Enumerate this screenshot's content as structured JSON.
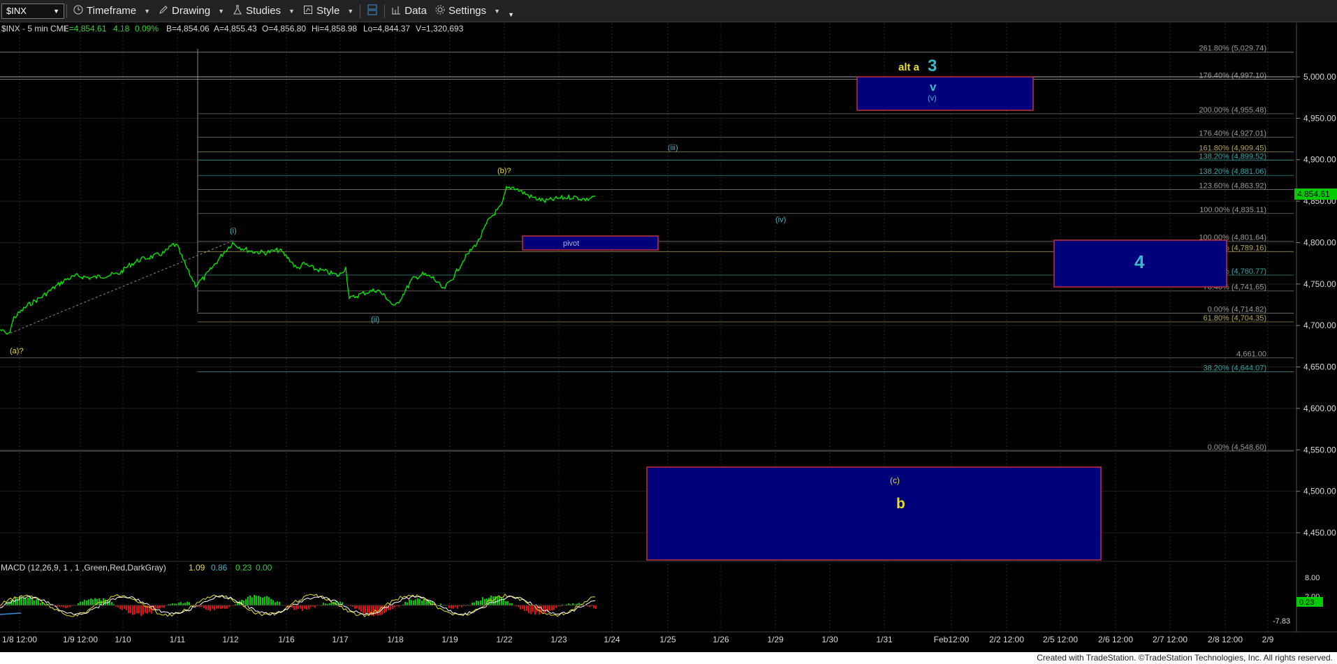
{
  "toolbar": {
    "symbol": "$INX",
    "timeframe": "Timeframe",
    "drawing": "Drawing",
    "studies": "Studies",
    "style": "Style",
    "data": "Data",
    "settings": "Settings"
  },
  "header": {
    "symbol_info": "$INX - 5 min  CME",
    "last": "L=4,854.61",
    "change": "4.18",
    "change_pct": "0.09%",
    "bid": "B=4,854.06",
    "ask": "A=4,855.43",
    "open": "O=4,856.80",
    "high": "Hi=4,858.98",
    "low": "Lo=4,844.37",
    "volume": "V=1,320,693"
  },
  "price_axis": {
    "ticks": [
      "5,000.00",
      "4,950.00",
      "4,900.00",
      "4,850.00",
      "4,800.00",
      "4,750.00",
      "4,700.00",
      "4,650.00",
      "4,600.00",
      "4,550.00",
      "4,500.00",
      "4,450.00"
    ],
    "last_price_label": "4,854.61"
  },
  "time_axis": {
    "ticks": [
      "1/8 12:00",
      "1/9 12:00",
      "1/10",
      "1/11",
      "1/12",
      "1/16",
      "1/17",
      "1/18",
      "1/19",
      "1/22",
      "1/23",
      "1/24",
      "1/25",
      "1/26",
      "1/29",
      "1/30",
      "1/31",
      "Feb12:00",
      "2/2 12:00",
      "2/5 12:00",
      "2/6 12:00",
      "2/7 12:00",
      "2/8 12:00",
      "2/9"
    ]
  },
  "fib_levels": [
    {
      "label": "261.80% (5,029.74)",
      "price": 5029.74,
      "color": "#9a9a9a"
    },
    {
      "label": "176.40% (4,997.10)",
      "price": 4997.1,
      "color": "#9a9a9a"
    },
    {
      "label": "200.00% (4,955.48)",
      "price": 4955.48,
      "color": "#9a9a9a"
    },
    {
      "label": "176.40% (4,927.01)",
      "price": 4927.01,
      "color": "#9a9a9a"
    },
    {
      "label": "161.80% (4,909.45)",
      "price": 4909.45,
      "color": "#b3a45a"
    },
    {
      "label": "138.20% (4,899.52)",
      "price": 4899.52,
      "color": "#3aa3a3"
    },
    {
      "label": "138.20% (4,881.06)",
      "price": 4881.06,
      "color": "#3aa3a3"
    },
    {
      "label": "123.60% (4,863.92)",
      "price": 4863.92,
      "color": "#9a9a9a"
    },
    {
      "label": "100.00% (4,835.11)",
      "price": 4835.11,
      "color": "#9a9a9a"
    },
    {
      "label": "100.00% (4,801.64)",
      "price": 4801.64,
      "color": "#9a9a9a"
    },
    {
      "label": "61.80% (4,789.16)",
      "price": 4789.16,
      "color": "#b3a45a"
    },
    {
      "label": "38.20% (4,760.77)",
      "price": 4760.77,
      "color": "#3aa3a3"
    },
    {
      "label": "76.40% (4,741.65)",
      "price": 4741.65,
      "color": "#9a9a9a"
    },
    {
      "label": "0.00% (4,714.82)",
      "price": 4714.82,
      "color": "#9a9a9a"
    },
    {
      "label": "61.80% (4,704.35)",
      "price": 4704.35,
      "color": "#b3a45a"
    },
    {
      "label": "4,661.00",
      "price": 4661.0,
      "color": "#9a9a9a"
    },
    {
      "label": "38.20% (4,644.07)",
      "price": 4644.07,
      "color": "#3aa3a3"
    },
    {
      "label": "0.00% (4,548.60)",
      "price": 4548.6,
      "color": "#9a9a9a"
    }
  ],
  "annotations": {
    "a_wave": "(a)?",
    "b_wave": "(b)?",
    "wave_i": "(i)",
    "wave_ii": "(ii)",
    "wave_iii": "(iii)",
    "wave_iv": "(iv)",
    "wave_v_small": "(v)",
    "wave_v": "v",
    "alt_a": "alt a",
    "alt_3": "3",
    "wave_4": "4",
    "pivot": "pivot",
    "c_wave": "(c)",
    "b_big": "b"
  },
  "macd": {
    "title": "MACD (12,26,9, 1 , 1 ,Green,Red,DarkGray)",
    "v1": "1.09",
    "v2": "0.86",
    "v3": "0.23",
    "v4": "0.00",
    "axis_ticks": [
      "8.00",
      "2.00",
      "-7.83"
    ],
    "current_label": "0.23"
  },
  "footer": "Created with TradeStation. ©TradeStation Technologies, Inc. All rights reserved.",
  "colors": {
    "price_line": "#00ee00",
    "zone_fill": "#00007a",
    "zone_border": "#c0303a",
    "wave_yellow": "#e6dd2a",
    "wave_cyan": "#3bb8c8"
  }
}
